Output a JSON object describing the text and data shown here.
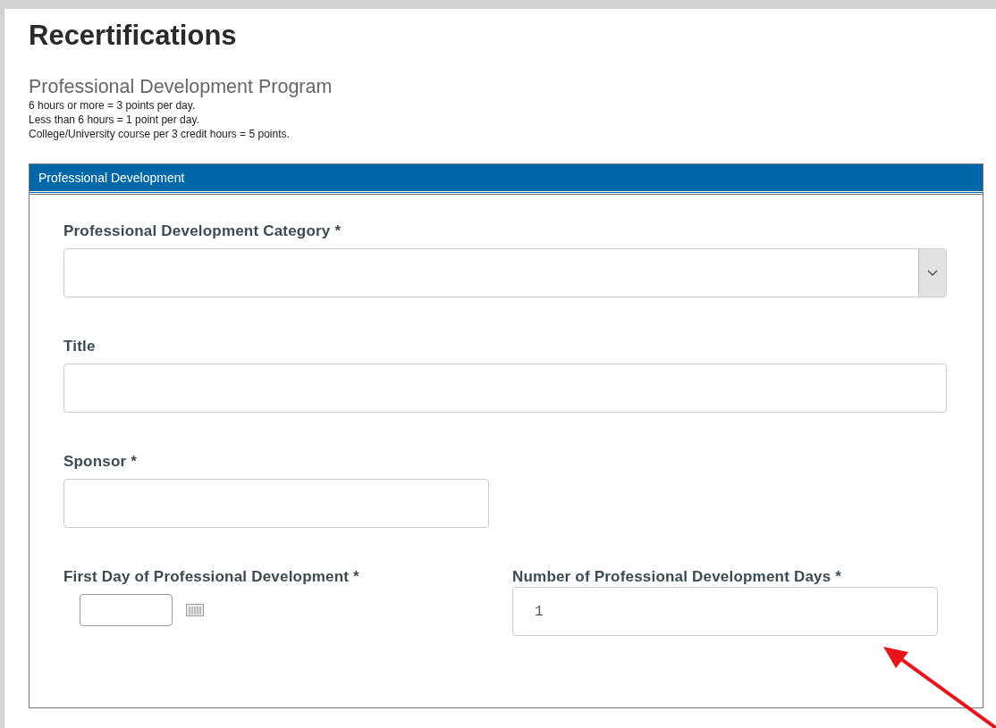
{
  "heading": "Recertifications",
  "program": {
    "title": "Professional Development Program",
    "notes": [
      "6 hours or more = 3 points per day.",
      "Less than 6 hours = 1 point per day.",
      "College/University course per 3 credit hours = 5 points."
    ]
  },
  "panel": {
    "title": "Professional Development",
    "fields": [
      {
        "kind": "select",
        "label": "Professional Development Category *"
      },
      {
        "kind": "text",
        "label": "Title"
      },
      {
        "kind": "short",
        "label": "Sponsor *"
      }
    ],
    "date_field": {
      "label": "First Day of Professional Development *"
    },
    "days_field": {
      "label": "Number of Professional Development Days *",
      "value": "1"
    }
  }
}
